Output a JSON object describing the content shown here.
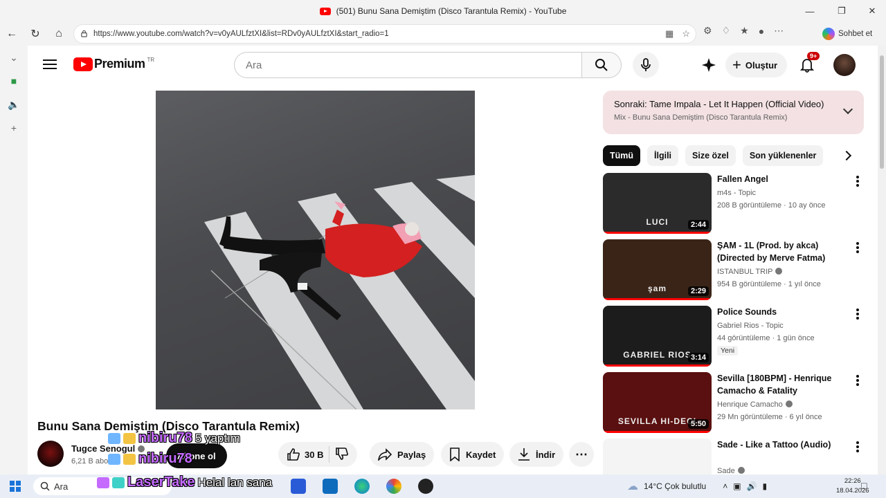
{
  "browser": {
    "tab_title": "(501) Bunu Sana Demiştim (Disco Tarantula Remix) - YouTube",
    "url": "https://www.youtube.com/watch?v=v0yAULfztXI&list=RDv0yAULfztXI&start_radio=1",
    "copilot_label": "Sohbet et"
  },
  "header": {
    "logo_text": "Premium",
    "logo_country": "TR",
    "search_placeholder": "Ara",
    "create_label": "Oluştur",
    "notification_count": "9+"
  },
  "video": {
    "title": "Bunu Sana Demiştim (Disco Tarantula Remix)",
    "channel": "Tugce Senogul",
    "subscribers": "6,21 B abone",
    "subscribe_label": "Abone ol",
    "likes": "30 B",
    "share_label": "Paylaş",
    "save_label": "Kaydet",
    "download_label": "İndir"
  },
  "overlay": {
    "user1": "nibiru78",
    "msg1": "5 yaptım",
    "user2": "nibiru78",
    "user3": "LaserTake",
    "msg3": "Helal lan sana"
  },
  "up_next": {
    "title": "Sonraki: Tame Impala - Let It Happen (Official Video)",
    "subtitle": "Mix - Bunu Sana Demiştim (Disco Tarantula Remix)"
  },
  "chips": [
    "Tümü",
    "İlgili",
    "Size özel",
    "Son yüklenenler"
  ],
  "recommendations": [
    {
      "title": "Fallen Angel",
      "channel": "m4s - Topic",
      "stats": "208 B görüntüleme · 10 ay önce",
      "duration": "2:44",
      "thumb_text": "LUCI",
      "thumb_color": "#2b2b2b",
      "verified": false,
      "is_new": false
    },
    {
      "title": "ŞAM - 1L (Prod. by akca) (Directed by Merve Fatma)",
      "channel": "ISTANBUL TRIP",
      "stats": "954 B görüntüleme · 1 yıl önce",
      "duration": "2:29",
      "thumb_text": "şam",
      "thumb_color": "#3a2418",
      "verified": true,
      "is_new": false
    },
    {
      "title": "Police Sounds",
      "channel": "Gabriel Rios - Topic",
      "stats": "44 görüntüleme · 1 gün önce",
      "duration": "3:14",
      "thumb_text": "GABRIEL RIOS",
      "thumb_color": "#1c1c1c",
      "verified": false,
      "is_new": true,
      "new_label": "Yeni"
    },
    {
      "title": "Sevilla [180BPM] - Henrique Camacho & Fatality",
      "channel": "Henrique Camacho",
      "stats": "29 Mn görüntüleme · 6 yıl önce",
      "duration": "5:50",
      "thumb_text": "SEVILLA HI-DECI",
      "thumb_color": "#5a1010",
      "verified": true,
      "is_new": false
    },
    {
      "title": "Sade - Like a Tattoo (Audio)",
      "channel": "Sade",
      "stats": "",
      "duration": "",
      "thumb_text": "",
      "thumb_color": "#f4f4f4",
      "verified": true,
      "is_new": false
    }
  ],
  "taskbar": {
    "search_label": "Ara",
    "weather": "14°C  Çok bulutlu",
    "time": "22:26",
    "date": "18.04.2026"
  }
}
